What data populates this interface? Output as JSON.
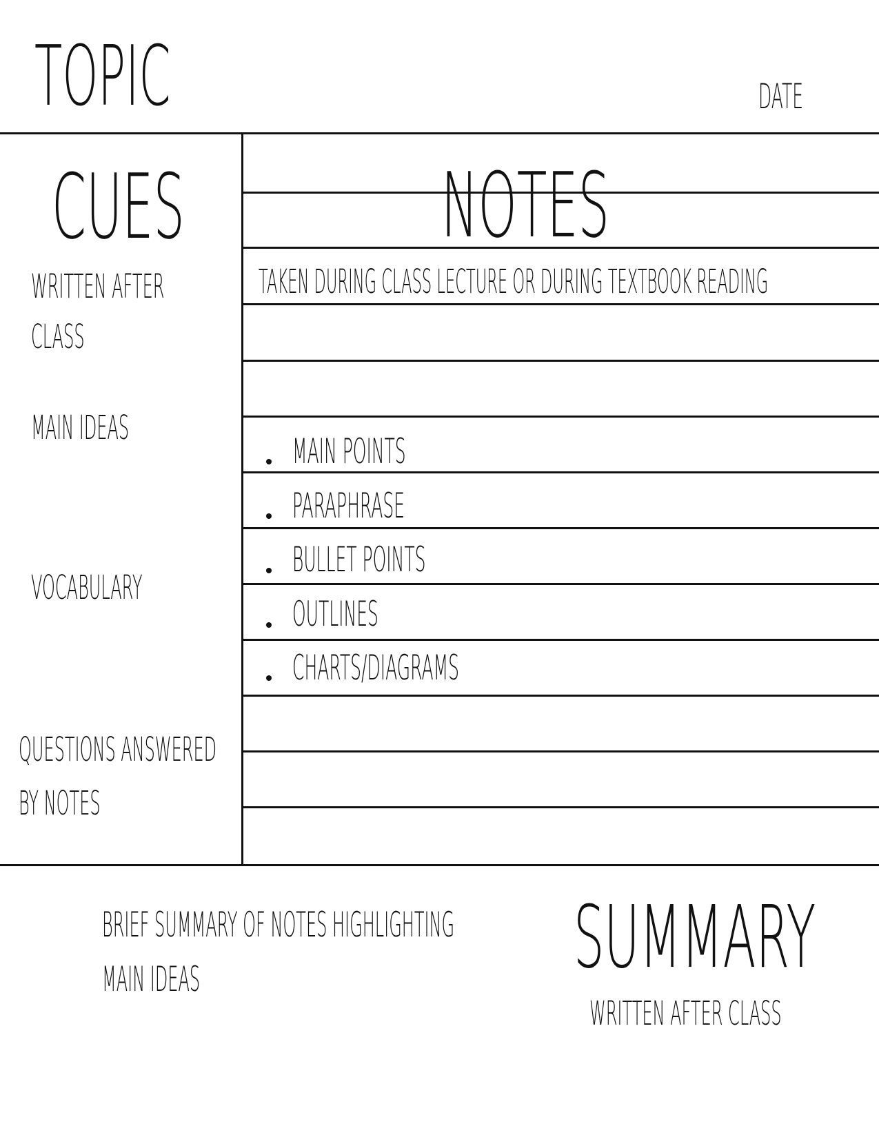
{
  "header": {
    "topic": "TOPIC",
    "date": "DATE"
  },
  "cues": {
    "title": "CUES",
    "items": [
      "WRITTEN AFTER",
      "CLASS",
      "MAIN IDEAS",
      "VOCABULARY",
      "QUESTIONS ANSWERED",
      "BY NOTES"
    ]
  },
  "notes": {
    "title": "NOTES",
    "description": "TAKEN DURING CLASS LECTURE OR DURING TEXTBOOK READING",
    "bullets": [
      "MAIN POINTS",
      "PARAPHRASE",
      "BULLET POINTS",
      "OUTLINES",
      "CHARTS/DIAGRAMS"
    ]
  },
  "summary": {
    "title": "SUMMARY",
    "subtitle": "WRITTEN AFTER CLASS",
    "description_lines": [
      "BRIEF SUMMARY OF NOTES HIGHLIGHTING",
      "MAIN IDEAS"
    ]
  }
}
